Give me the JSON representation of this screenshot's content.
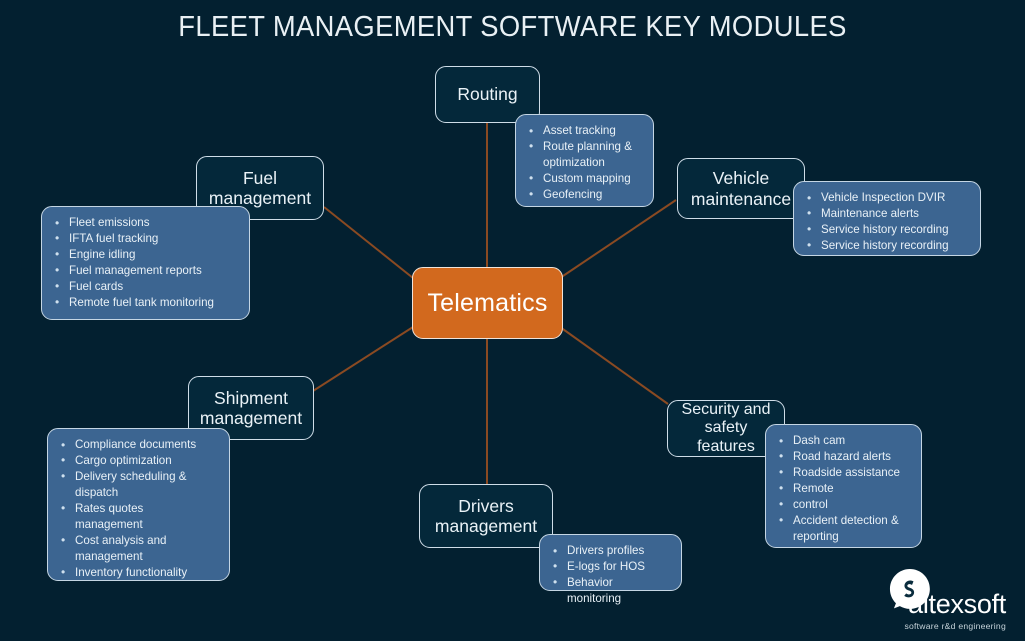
{
  "title": "FLEET MANAGEMENT SOFTWARE KEY MODULES",
  "colors": {
    "background": "#032030",
    "hub_fill": "#d2691e",
    "feature_fill": "#3c6591",
    "module_border": "#cfdde8",
    "connector": "#8a4a22",
    "title_text": "#e9f0f4"
  },
  "hub": {
    "label": "Telematics"
  },
  "modules": [
    {
      "id": "routing",
      "label": "Routing",
      "features": [
        "Asset tracking",
        "Route planning &\noptimization",
        "Custom mapping",
        "Geofencing"
      ]
    },
    {
      "id": "vehicle-maintenance",
      "label": "Vehicle\nmaintenance",
      "features": [
        "Vehicle Inspection DVIR",
        "Maintenance alerts",
        "Service history recording",
        "Service history recording"
      ]
    },
    {
      "id": "fuel-management",
      "label": "Fuel\nmanagement",
      "features": [
        "Fleet emissions",
        "IFTA fuel tracking",
        "Engine idling",
        "Fuel management reports",
        "Fuel cards",
        "Remote fuel tank monitoring"
      ]
    },
    {
      "id": "shipment-management",
      "label": "Shipment\nmanagement",
      "features": [
        "Compliance documents",
        "Cargo optimization",
        "Delivery scheduling &\ndispatch",
        "Rates quotes\nmanagement",
        "Cost analysis and\nmanagement",
        "Inventory functionality"
      ]
    },
    {
      "id": "drivers-management",
      "label": "Drivers\nmanagement",
      "features": [
        "Drivers profiles",
        "E-logs for HOS",
        "Behavior monitoring"
      ]
    },
    {
      "id": "security-safety",
      "label": "Security and\nsafety\nfeatures",
      "features": [
        "Dash cam",
        "Road hazard alerts",
        "Roadside assistance",
        "Remote",
        " control",
        "Accident detection &\nreporting"
      ]
    }
  ],
  "logo": {
    "name": "altexsoft",
    "tagline": "software r&d engineering",
    "mark": "altexsoft-logo-mark"
  }
}
